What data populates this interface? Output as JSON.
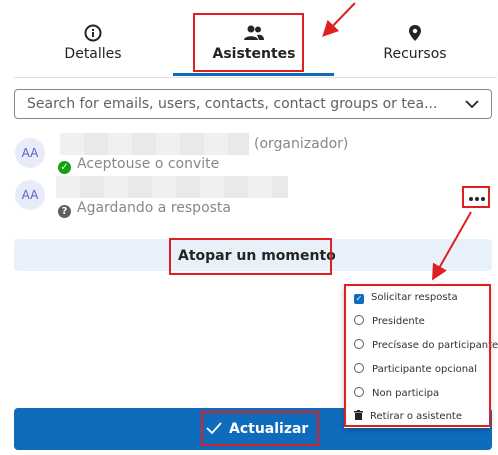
{
  "tabs": [
    {
      "label": "Detalles",
      "icon": "info-icon"
    },
    {
      "label": "Asistentes",
      "icon": "people-icon",
      "active": true
    },
    {
      "label": "Recursos",
      "icon": "location-pin-icon"
    }
  ],
  "search": {
    "placeholder": "Search for emails, users, contacts, contact groups or tea..."
  },
  "attendees": [
    {
      "initials": "AA",
      "role": "(organizador)",
      "status": "Aceptouse o convite",
      "status_icon": "check-circle-icon"
    },
    {
      "initials": "AA",
      "role": "",
      "status": "Agardando a resposta",
      "status_icon": "question-circle-icon"
    }
  ],
  "find_time_label": "Atopar un momento",
  "context_menu": {
    "items": [
      {
        "label": "Solicitar resposta",
        "type": "checkbox",
        "checked": true
      },
      {
        "label": "Presidente",
        "type": "radio"
      },
      {
        "label": "Precísase do participante",
        "type": "radio"
      },
      {
        "label": "Participante opcional",
        "type": "radio"
      },
      {
        "label": "Non participa",
        "type": "radio"
      },
      {
        "label": "Retirar o asistente",
        "type": "action",
        "icon": "trash-icon"
      }
    ]
  },
  "update_label": "Actualizar",
  "colors": {
    "accent": "#0f6cbd",
    "annotation": "#e02020",
    "success": "#13a10e"
  }
}
